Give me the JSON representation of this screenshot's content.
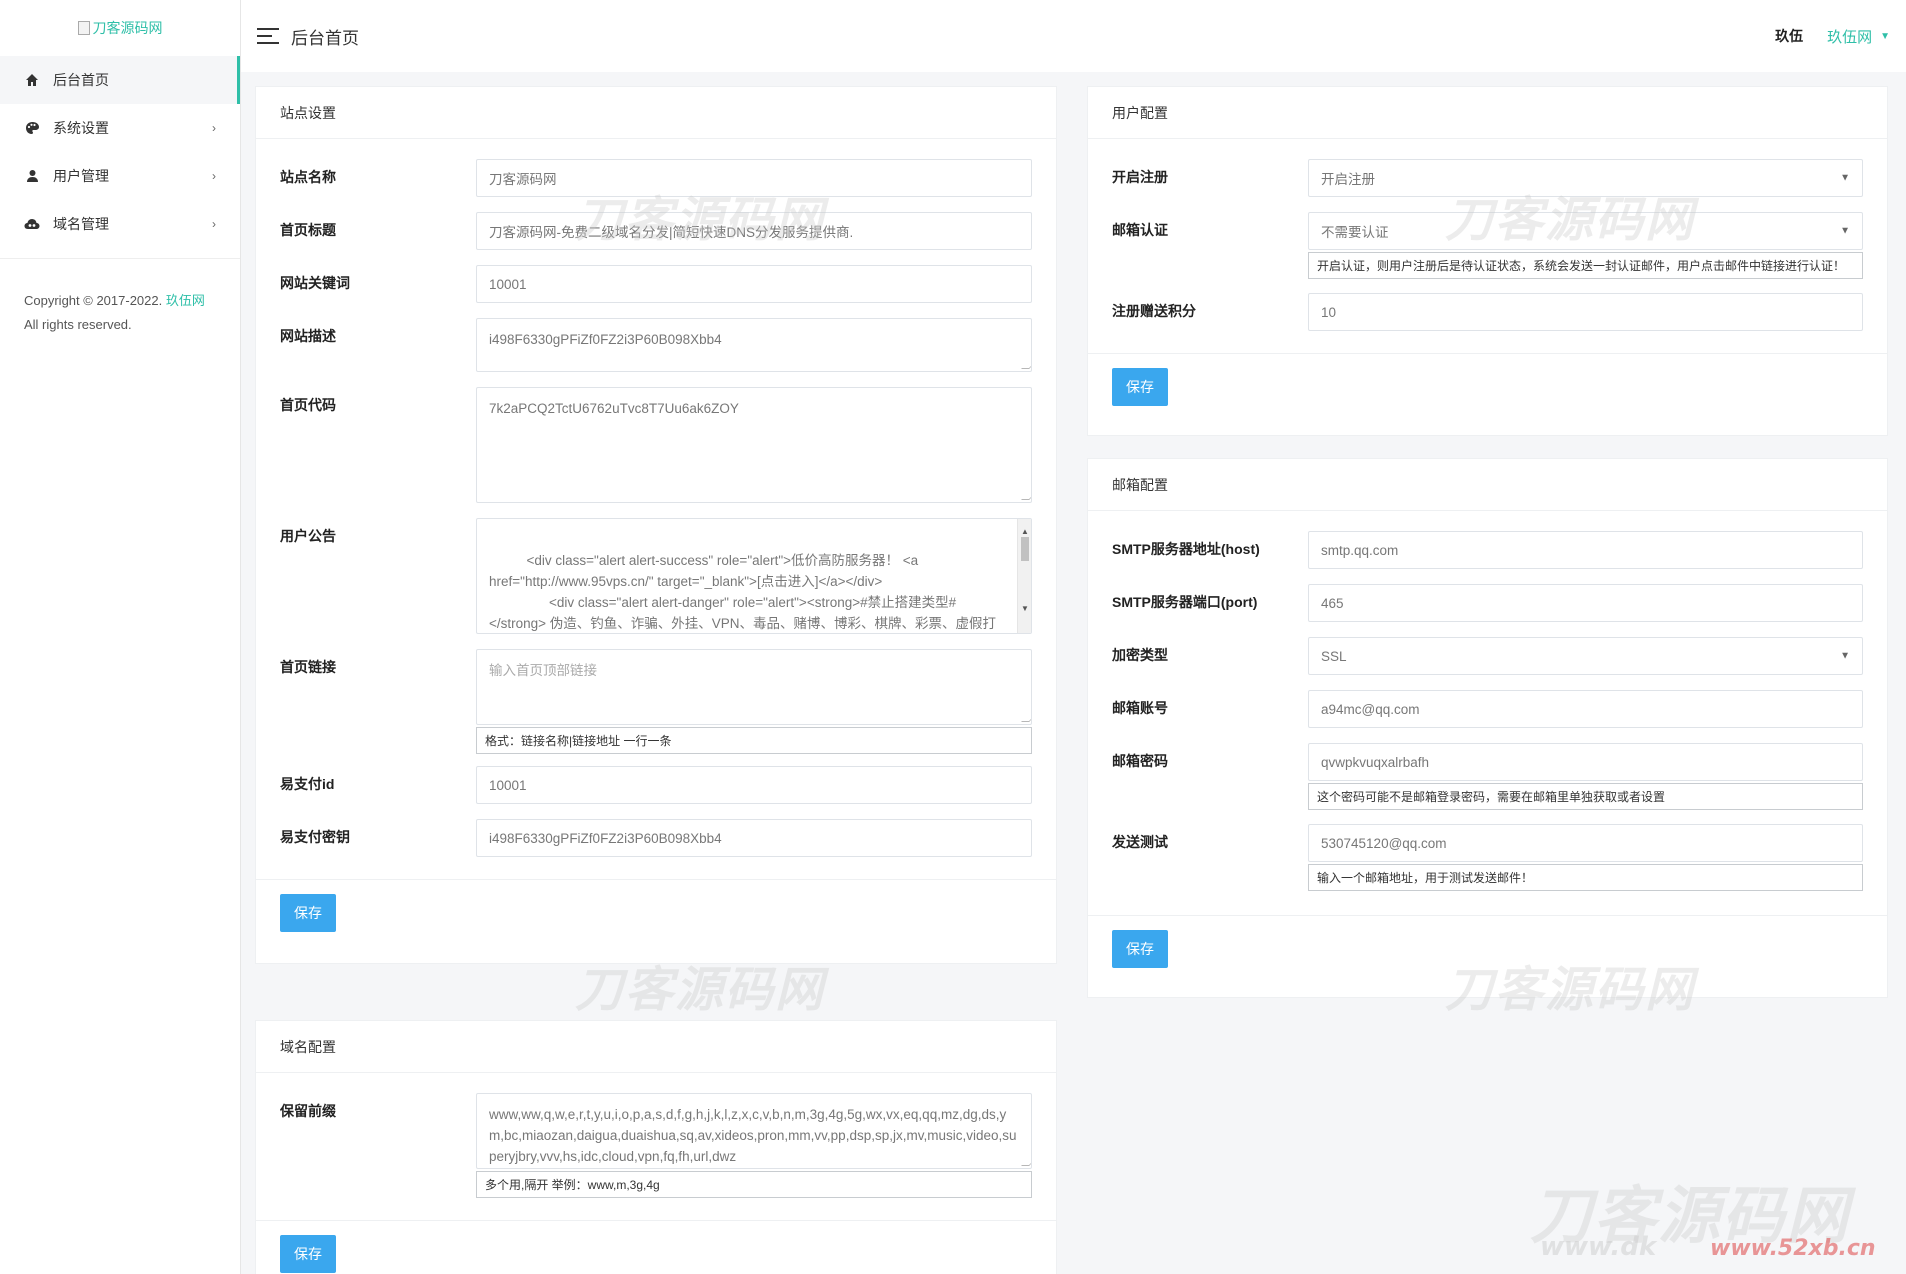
{
  "sidebar": {
    "logo_alt": "刀客源码网",
    "items": [
      {
        "label": "后台首页",
        "icon": "home-icon"
      },
      {
        "label": "系统设置",
        "icon": "palette-icon"
      },
      {
        "label": "用户管理",
        "icon": "user-icon"
      },
      {
        "label": "域名管理",
        "icon": "cloud-icon"
      }
    ],
    "copyright_prefix": "Copyright © 2017-2022.",
    "copyright_link": "玖伍网",
    "rights": "All rights reserved."
  },
  "header": {
    "title": "后台首页",
    "user": "玖伍",
    "site": "玖伍网"
  },
  "site_settings": {
    "title": "站点设置",
    "fields": {
      "site_name": {
        "label": "站点名称",
        "value": "刀客源码网"
      },
      "home_title": {
        "label": "首页标题",
        "value": "刀客源码网-免费二级域名分发|简短快速DNS分发服务提供商."
      },
      "keywords": {
        "label": "网站关键词",
        "value": "10001"
      },
      "description": {
        "label": "网站描述",
        "value": "i498F6330gPFiZf0FZ2i3P60B098Xbb4"
      },
      "home_code": {
        "label": "首页代码",
        "value": "7k2aPCQ2TctU6762uTvc8T7Uu6ak6ZOY"
      },
      "notice": {
        "label": "用户公告",
        "value": "<div class=\"alert alert-success\" role=\"alert\">低价高防服务器！ <a href=\"http://www.95vps.cn/\" target=\"_blank\">[点击进入]</a></div>\n                <div class=\"alert alert-danger\" role=\"alert\"><strong>#禁止搭建类型#</strong> 伪造、钓鱼、诈骗、外挂、VPN、毒品、赌博、博彩、棋牌、彩票、虚假打赏、黄色、贷款、色情交友、盗版影视、不正常言论、不合法的信息收集、圈"
      },
      "home_links": {
        "label": "首页链接",
        "placeholder": "输入首页顶部链接",
        "help": "格式：链接名称|链接地址 一行一条"
      },
      "pay_id": {
        "label": "易支付id",
        "value": "10001"
      },
      "pay_key": {
        "label": "易支付密钥",
        "value": "i498F6330gPFiZf0FZ2i3P60B098Xbb4"
      }
    },
    "save": "保存"
  },
  "user_config": {
    "title": "用户配置",
    "fields": {
      "register": {
        "label": "开启注册",
        "value": "开启注册"
      },
      "email_verify": {
        "label": "邮箱认证",
        "value": "不需要认证",
        "help": "开启认证，则用户注册后是待认证状态，系统会发送一封认证邮件，用户点击邮件中链接进行认证！"
      },
      "reg_points": {
        "label": "注册赠送积分",
        "value": "10"
      }
    },
    "save": "保存"
  },
  "mail_config": {
    "title": "邮箱配置",
    "fields": {
      "host": {
        "label": "SMTP服务器地址(host)",
        "value": "smtp.qq.com"
      },
      "port": {
        "label": "SMTP服务器端口(port)",
        "value": "465"
      },
      "encrypt": {
        "label": "加密类型",
        "value": "SSL"
      },
      "account": {
        "label": "邮箱账号",
        "value": "a94mc@qq.com"
      },
      "password": {
        "label": "邮箱密码",
        "value": "qvwpkvuqxalrbafh",
        "help": "这个密码可能不是邮箱登录密码，需要在邮箱里单独获取或者设置"
      },
      "test": {
        "label": "发送测试",
        "value": "530745120@qq.com",
        "help": "输入一个邮箱地址，用于测试发送邮件！"
      }
    },
    "save": "保存"
  },
  "domain_config": {
    "title": "域名配置",
    "fields": {
      "reserved": {
        "label": "保留前缀",
        "value": "www,ww,q,w,e,r,t,y,u,i,o,p,a,s,d,f,g,h,j,k,l,z,x,c,v,b,n,m,3g,4g,5g,wx,vx,eq,qq,mz,dg,ds,ym,bc,miaozan,daigua,duaishua,sq,av,xideos,pron,mm,vv,pp,dsp,sp,jx,mv,music,video,superyjbry,vvv,hs,idc,cloud,vpn,fq,fh,url,dwz",
        "help": "多个用,隔开 举例：www,m,3g,4g"
      }
    },
    "save": "保存"
  },
  "watermark": {
    "text": "刀客源码网",
    "url_left": "www.dk",
    "url_right": "www.52xb.cn"
  }
}
